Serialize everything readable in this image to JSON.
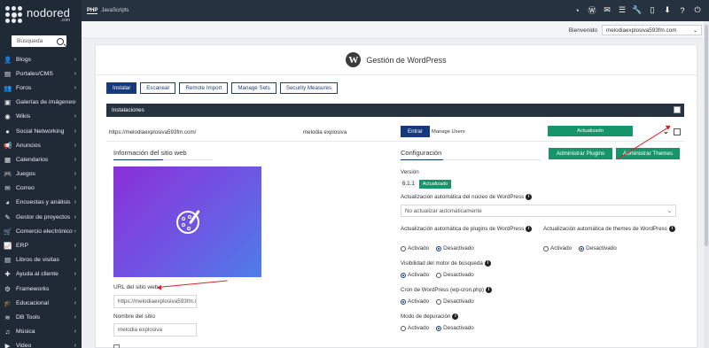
{
  "logo": {
    "name": "nodored",
    "sub": ".com"
  },
  "search": {
    "placeholder": "Búsqueda"
  },
  "sidebar": {
    "items": [
      {
        "icon": "👤",
        "icon_name": "user-icon",
        "label": "Blogs"
      },
      {
        "icon": "▤",
        "icon_name": "portal-icon",
        "label": "Portales/CMS"
      },
      {
        "icon": "👥",
        "icon_name": "users-icon",
        "label": "Foros"
      },
      {
        "icon": "▣",
        "icon_name": "image-gallery-icon",
        "label": "Galerías de imágenes"
      },
      {
        "icon": "◉",
        "icon_name": "wiki-icon",
        "label": "Wikis"
      },
      {
        "icon": "●",
        "icon_name": "social-icon",
        "label": "Social Networking"
      },
      {
        "icon": "📢",
        "icon_name": "megaphone-icon",
        "label": "Anuncios"
      },
      {
        "icon": "▦",
        "icon_name": "calendar-icon",
        "label": "Calendarios"
      },
      {
        "icon": "🎮",
        "icon_name": "gamepad-icon",
        "label": "Juegos"
      },
      {
        "icon": "✉",
        "icon_name": "mail-icon",
        "label": "Correo"
      },
      {
        "icon": "◕",
        "icon_name": "chart-pie-icon",
        "label": "Encuestas y análisis"
      },
      {
        "icon": "✎",
        "icon_name": "project-icon",
        "label": "Gestor de proyectos"
      },
      {
        "icon": "🛒",
        "icon_name": "cart-icon",
        "label": "Comercio electrónico"
      },
      {
        "icon": "📈",
        "icon_name": "erp-chart-icon",
        "label": "ERP"
      },
      {
        "icon": "▤",
        "icon_name": "guestbook-icon",
        "label": "Libros de visitas"
      },
      {
        "icon": "✚",
        "icon_name": "support-icon",
        "label": "Ayuda al cliente"
      },
      {
        "icon": "⚙",
        "icon_name": "gears-icon",
        "label": "Frameworks"
      },
      {
        "icon": "🎓",
        "icon_name": "graduation-icon",
        "label": "Educacional"
      },
      {
        "icon": "≋",
        "icon_name": "database-icon",
        "label": "DB Tools"
      },
      {
        "icon": "♫",
        "icon_name": "music-icon",
        "label": "Música"
      },
      {
        "icon": "▶",
        "icon_name": "video-icon",
        "label": "Video"
      }
    ]
  },
  "topbar": {
    "php": "PHP",
    "link": "JavaScripts"
  },
  "account": {
    "welcome": "Bienvenido",
    "domain": "melodiaexplosiva593fm.com"
  },
  "card": {
    "title": "Gestión de WordPress"
  },
  "tabs": [
    "Instalar",
    "Escanear",
    "Remote Import",
    "Manage Sets",
    "Security Measures"
  ],
  "installs": {
    "section_title": "Instalaciones",
    "row": {
      "url": "https://melodiaexplosiva593fm.com/",
      "name": "melodia explosiva",
      "enter": "Entrar",
      "manage_users": "Manage Users",
      "status": "Actualizado"
    }
  },
  "site_info": {
    "title": "Información del sitio web",
    "url_label": "URL del sitio web",
    "url_value": "https://melodiaexplosiva593fm.com/",
    "name_label": "Nombre del sitio",
    "name_value": "melodia explosiva"
  },
  "config": {
    "title": "Configuración",
    "admin_plugins": "Administrar Plugins",
    "admin_themes": "Administrar Themes",
    "version_label": "Versión",
    "version": "6.1.1",
    "version_badge": "Actualizado",
    "core_update_label": "Actualización automática del núcleo de WordPress",
    "core_update_value": "No actualizar automáticamente",
    "plugins_update_label": "Actualización automática de plugins de WordPress",
    "themes_update_label": "Actualización automática de themes de WordPress",
    "visibility_label": "Visibilidad del motor de búsqueda",
    "cron_label": "Cron de WordPress (wp-cron.php)",
    "debug_label": "Modo de depuración",
    "on": "Activado",
    "off": "Desactivado"
  }
}
